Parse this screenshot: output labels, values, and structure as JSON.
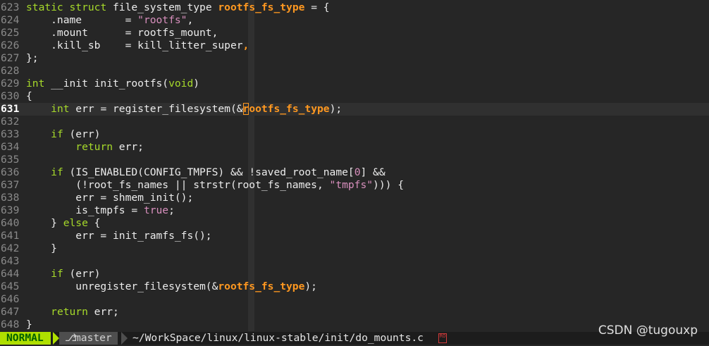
{
  "editor": {
    "current_line": 631,
    "lines": [
      {
        "n": "623",
        "segments": [
          [
            "kw",
            "static"
          ],
          [
            "id",
            " "
          ],
          [
            "kw",
            "struct"
          ],
          [
            "id",
            " file_system_type "
          ],
          [
            "strong",
            "rootfs_fs_type"
          ],
          [
            "id",
            " = {"
          ]
        ]
      },
      {
        "n": "624",
        "segments": [
          [
            "id",
            "    .name       = "
          ],
          [
            "str",
            "\"rootfs\""
          ],
          [
            "id",
            ","
          ]
        ]
      },
      {
        "n": "625",
        "segments": [
          [
            "id",
            "    .mount      = rootfs_mount,"
          ]
        ]
      },
      {
        "n": "626",
        "segments": [
          [
            "id",
            "    .kill_sb    = kill_litter_super"
          ],
          [
            "strong",
            ","
          ]
        ]
      },
      {
        "n": "627",
        "segments": [
          [
            "id",
            "};"
          ]
        ]
      },
      {
        "n": "628",
        "segments": []
      },
      {
        "n": "629",
        "segments": [
          [
            "ty",
            "int"
          ],
          [
            "id",
            " __init init_rootfs("
          ],
          [
            "ty",
            "void"
          ],
          [
            "id",
            ")"
          ]
        ]
      },
      {
        "n": "630",
        "segments": [
          [
            "id",
            "{"
          ]
        ]
      },
      {
        "n": "631",
        "segments": [
          [
            "id",
            "    "
          ],
          [
            "ty",
            "int"
          ],
          [
            "id",
            " err = register_filesystem(&"
          ],
          [
            "cursor",
            "r"
          ],
          [
            "strong",
            "ootfs_fs_type"
          ],
          [
            "id",
            ");"
          ]
        ]
      },
      {
        "n": "632",
        "segments": []
      },
      {
        "n": "633",
        "segments": [
          [
            "id",
            "    "
          ],
          [
            "kw",
            "if"
          ],
          [
            "id",
            " (err)"
          ]
        ]
      },
      {
        "n": "634",
        "segments": [
          [
            "id",
            "        "
          ],
          [
            "kw",
            "return"
          ],
          [
            "id",
            " err;"
          ]
        ]
      },
      {
        "n": "635",
        "segments": []
      },
      {
        "n": "636",
        "segments": [
          [
            "id",
            "    "
          ],
          [
            "kw",
            "if"
          ],
          [
            "id",
            " (IS_ENABLED(CONFIG_TMPFS) && !saved_root_name["
          ],
          [
            "num",
            "0"
          ],
          [
            "id",
            "] &&"
          ]
        ]
      },
      {
        "n": "637",
        "segments": [
          [
            "id",
            "        (!root_fs_names || strstr(root_fs_names, "
          ],
          [
            "str",
            "\"tmpfs\""
          ],
          [
            "id",
            "))) {"
          ]
        ]
      },
      {
        "n": "638",
        "segments": [
          [
            "id",
            "        err = shmem_init();"
          ]
        ]
      },
      {
        "n": "639",
        "segments": [
          [
            "id",
            "        is_tmpfs = "
          ],
          [
            "bool",
            "true"
          ],
          [
            "id",
            ";"
          ]
        ]
      },
      {
        "n": "640",
        "segments": [
          [
            "id",
            "    } "
          ],
          [
            "kw",
            "else"
          ],
          [
            "id",
            " {"
          ]
        ]
      },
      {
        "n": "641",
        "segments": [
          [
            "id",
            "        err = init_ramfs_fs();"
          ]
        ]
      },
      {
        "n": "642",
        "segments": [
          [
            "id",
            "    }"
          ]
        ]
      },
      {
        "n": "643",
        "segments": []
      },
      {
        "n": "644",
        "segments": [
          [
            "id",
            "    "
          ],
          [
            "kw",
            "if"
          ],
          [
            "id",
            " (err)"
          ]
        ]
      },
      {
        "n": "645",
        "segments": [
          [
            "id",
            "        unregister_filesystem(&"
          ],
          [
            "strong",
            "rootfs_fs_type"
          ],
          [
            "id",
            ");"
          ]
        ]
      },
      {
        "n": "646",
        "segments": []
      },
      {
        "n": "647",
        "segments": [
          [
            "id",
            "    "
          ],
          [
            "kw",
            "return"
          ],
          [
            "id",
            " err;"
          ]
        ]
      },
      {
        "n": "648",
        "segments": [
          [
            "id",
            "}"
          ]
        ]
      }
    ]
  },
  "statusline": {
    "mode": "NORMAL",
    "branch_icon": "⎇",
    "branch": "master",
    "filepath": "~/WorkSpace/linux/linux-stable/init/do_mounts.c",
    "readonly_icon": "lock-icon",
    "readonly_glyph": "RO"
  },
  "watermark": "CSDN @tugouxp",
  "colors": {
    "background": "#262626",
    "keyword": "#a6d92a",
    "highlight": "#ff9820",
    "string": "#d88fbd",
    "mode_bg": "#afdf00"
  }
}
